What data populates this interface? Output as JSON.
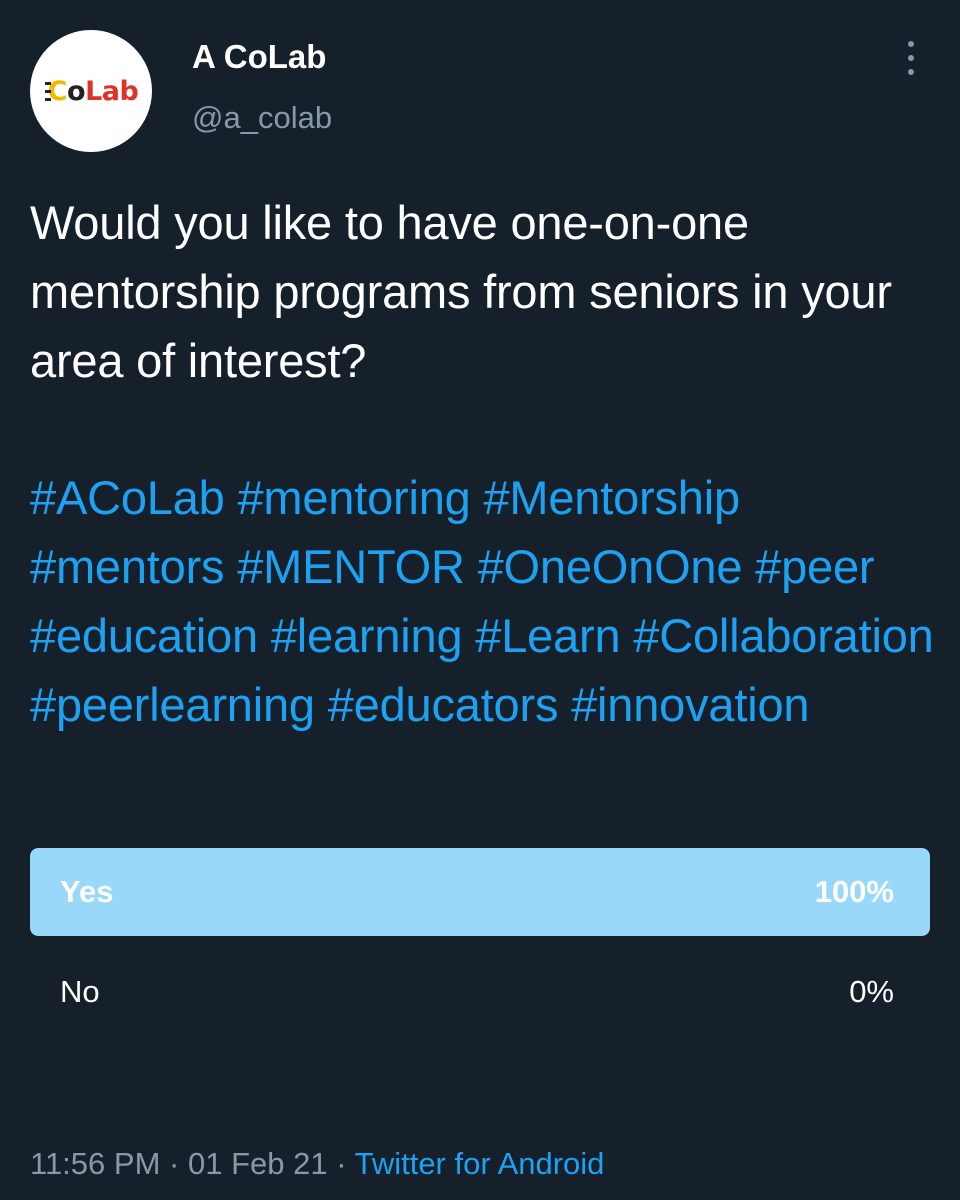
{
  "author": {
    "avatar_logo": {
      "c": "C",
      "o": "o",
      "lab": "Lab"
    },
    "name": "A CoLab",
    "handle": "@a_colab",
    "more_icon": "more-vertical-icon"
  },
  "tweet": {
    "text": "Would you like to have one-on-one mentorship programs from seniors in your area of interest?",
    "hashtags": [
      "#ACoLab",
      "#mentoring",
      "#Mentorship",
      "#mentors",
      "#MENTOR",
      "#OneOnOne",
      "#peer",
      "#education",
      "#learning",
      "#Learn",
      "#Collaboration",
      "#peerlearning",
      "#educators",
      "#innovation"
    ]
  },
  "poll": {
    "options": [
      {
        "label": "Yes",
        "percent_text": "100%",
        "fraction": 1.0
      },
      {
        "label": "No",
        "percent_text": "0%",
        "fraction": 0.0
      }
    ]
  },
  "footer": {
    "time": "11:56 PM",
    "sep1": "·",
    "date": "01 Feb 21",
    "sep2": "·",
    "source": "Twitter for Android"
  },
  "colors": {
    "background": "#15202b",
    "link": "#1da1f2",
    "secondary_text": "#8899a6",
    "poll_winner_fill": "#9ad8fa"
  }
}
